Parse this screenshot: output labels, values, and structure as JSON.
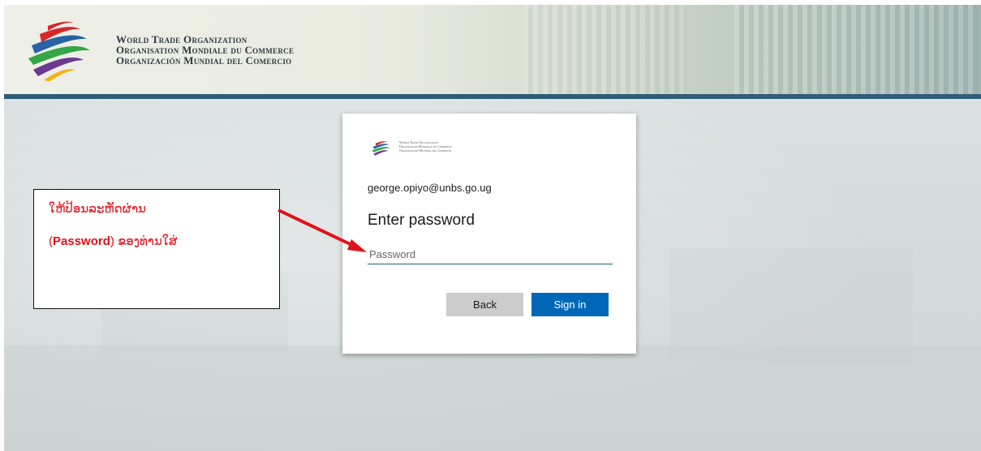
{
  "header": {
    "org_name_en": "World Trade Organization",
    "org_name_fr": "Organisation Mondiale du Commerce",
    "org_name_es": "Organización Mundial del Comercio"
  },
  "signin_card": {
    "org_name_en": "World Trade Organization",
    "org_name_fr": "Organisation Mondiale du Commerce",
    "org_name_es": "Organización Mundial del Comercio",
    "account": "george.opiyo@unbs.go.ug",
    "title": "Enter password",
    "password_placeholder": "Password",
    "password_value": "",
    "back_label": "Back",
    "signin_label": "Sign in"
  },
  "annotation": {
    "line1": "ໃຫ້ປ້ອນລະຫັດຜ່ານ",
    "open_paren": "(",
    "bold_word": "Password",
    "close_paren": ")",
    "line2_rest": " ຂອງທ່ານໃສ່"
  },
  "colors": {
    "accent": "#0067b8",
    "header_rule": "#2f5d78",
    "annotation_text": "#e0121b",
    "input_underline": "#106f6f",
    "back_button": "#cccccc"
  },
  "icons": {
    "logo": "wto-logo-icon",
    "arrow": "red-arrow"
  }
}
